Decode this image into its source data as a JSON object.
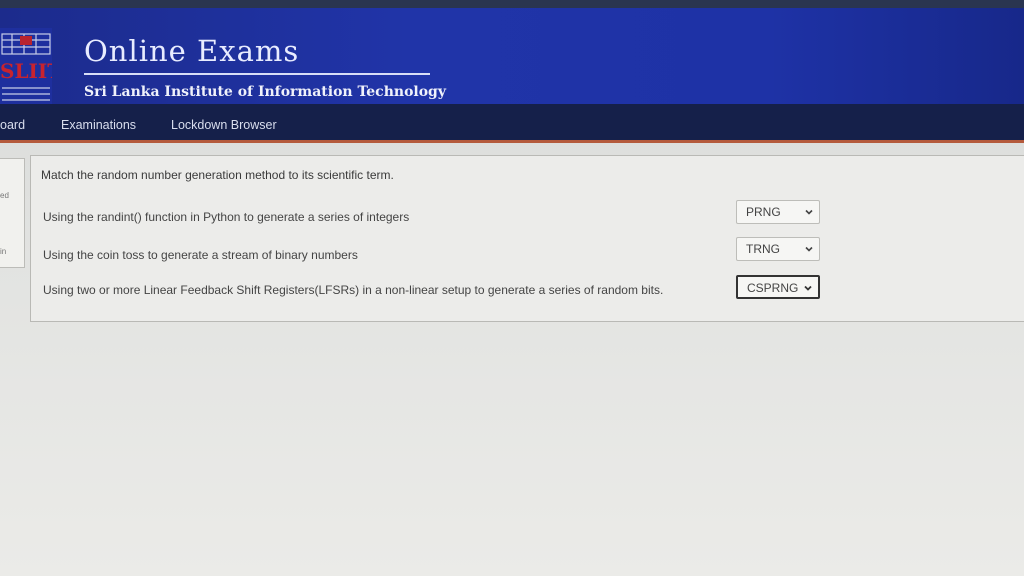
{
  "header": {
    "logo_text": "SLIIT",
    "title": "Online Exams",
    "subtitle": "Sri Lanka Institute of Information Technology"
  },
  "nav": {
    "items": [
      {
        "label": "oard"
      },
      {
        "label": "Examinations"
      },
      {
        "label": "Lockdown Browser"
      }
    ]
  },
  "sidebar": {
    "fragments": [
      "ed",
      "in"
    ]
  },
  "question": {
    "prompt": "Match the random number generation method to its scientific term.",
    "rows": [
      {
        "text": "Using the randint() function in Python to generate a series of integers",
        "selected": "PRNG"
      },
      {
        "text": "Using the coin toss to generate a stream of binary numbers",
        "selected": "TRNG"
      },
      {
        "text": "Using two or more Linear Feedback Shift Registers(LFSRs) in a non-linear setup to generate a series of random bits.",
        "selected": "CSPRNG"
      }
    ]
  },
  "colors": {
    "banner": "#1e32a6",
    "navbar": "#15204a",
    "accent": "#b45a3c",
    "logo": "#b8232e"
  }
}
